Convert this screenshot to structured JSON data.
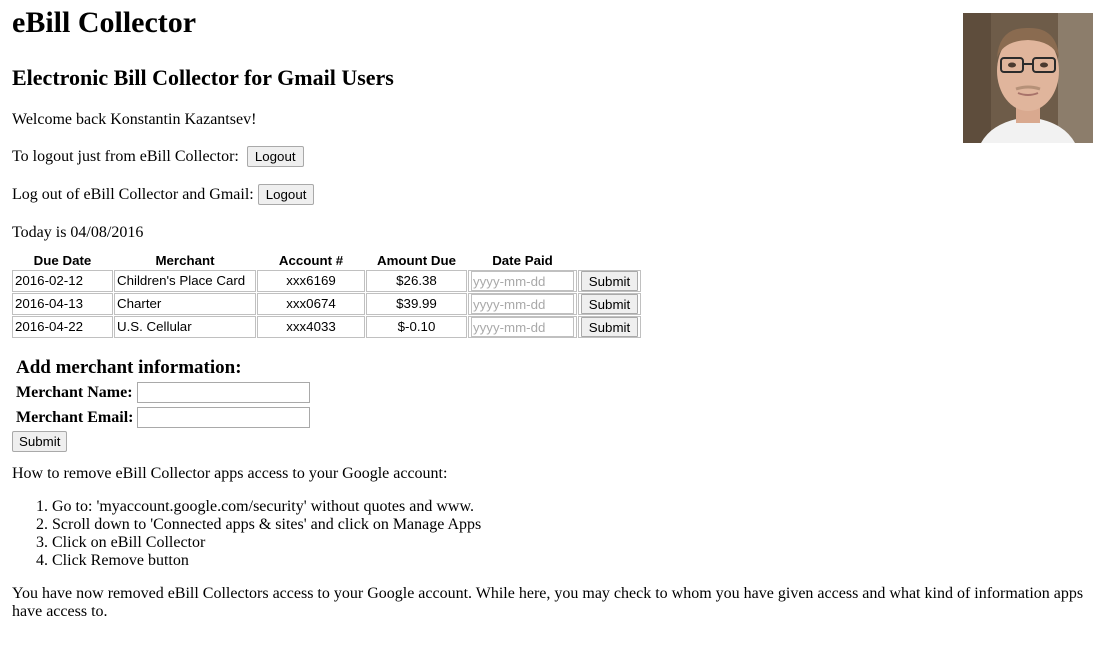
{
  "header": {
    "title": "eBill Collector",
    "subtitle": "Electronic Bill Collector for Gmail Users"
  },
  "session": {
    "welcome": "Welcome back Konstantin Kazantsev!",
    "logout_local_text": "To logout just from eBill Collector:",
    "logout_local_button": "Logout",
    "logout_all_text": "Log out of eBill Collector and Gmail:",
    "logout_all_button": "Logout",
    "today": "Today is 04/08/2016"
  },
  "bills": {
    "columns": [
      "Due Date",
      "Merchant",
      "Account #",
      "Amount Due",
      "Date Paid"
    ],
    "date_placeholder": "yyyy-mm-dd",
    "submit_label": "Submit",
    "rows": [
      {
        "due": "2016-02-12",
        "merchant": "Children's Place Card",
        "account": "xxx6169",
        "amount": "$26.38"
      },
      {
        "due": "2016-04-13",
        "merchant": "Charter",
        "account": "xxx0674",
        "amount": "$39.99"
      },
      {
        "due": "2016-04-22",
        "merchant": "U.S. Cellular",
        "account": "xxx4033",
        "amount": "$-0.10"
      }
    ]
  },
  "add_merchant": {
    "title": "Add merchant information:",
    "name_label": "Merchant Name:",
    "email_label": "Merchant Email:",
    "name_value": "",
    "email_value": "",
    "submit_label": "Submit"
  },
  "instructions": {
    "intro": "How to remove eBill Collector apps access to your Google account:",
    "steps": [
      "Go to: 'myaccount.google.com/security' without quotes and www.",
      "Scroll down to 'Connected apps & sites' and click on Manage Apps",
      "Click on eBill Collector",
      "Click Remove button"
    ],
    "final": "You have now removed eBill Collectors access to your Google account. While here, you may check to whom you have given access and what kind of information apps have access to."
  }
}
